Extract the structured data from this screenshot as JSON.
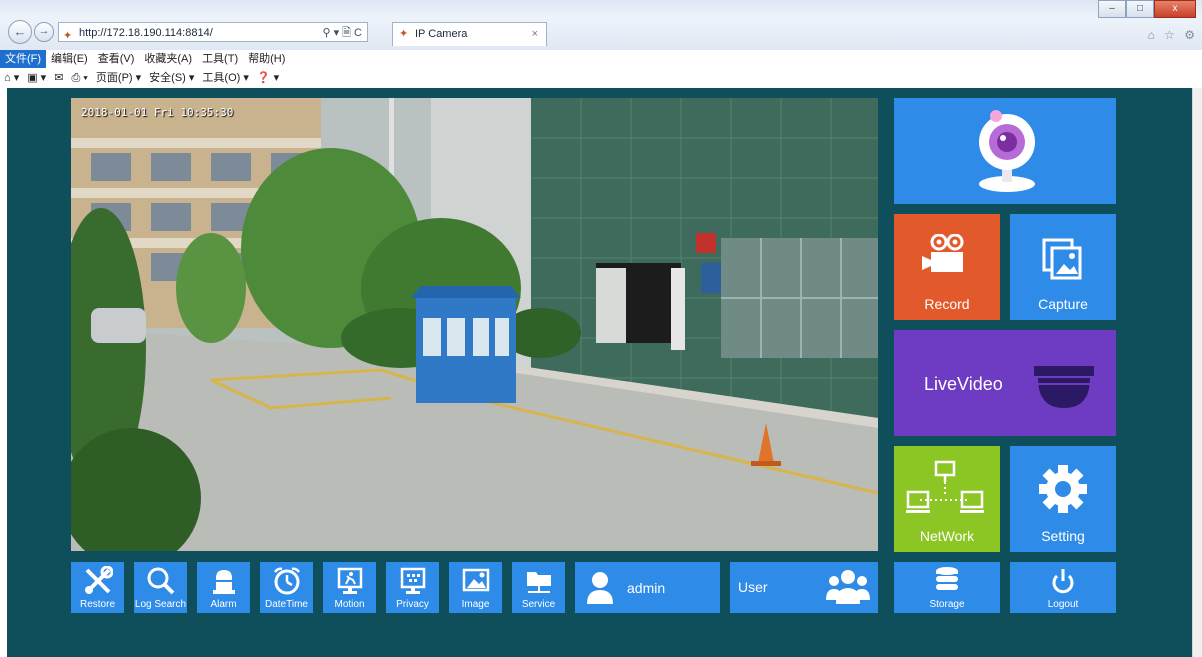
{
  "browser": {
    "url": "http://172.18.190.114:8814/",
    "address_tools": "⚲ ▾ 🗎 C",
    "tab_title": "IP Camera",
    "tab_close": "×",
    "back": "←",
    "forward": "→",
    "window_buttons": {
      "minimize": "–",
      "maximize": "□",
      "close": "x"
    },
    "right_icons": "⌂ ☆ ⚙"
  },
  "menu": [
    "文件(F)",
    "编辑(E)",
    "查看(V)",
    "收藏夹(A)",
    "工具(T)",
    "帮助(H)"
  ],
  "command_bar": [
    "⌂ ▾",
    "▣ ▾",
    "✉",
    "⎙ ▾",
    "页面(P) ▾",
    "安全(S) ▾",
    "工具(O) ▾",
    "❓ ▾"
  ],
  "video": {
    "osd_text": "2018-01-01 Fri 10:35:30"
  },
  "tiles": {
    "record": "Record",
    "capture": "Capture",
    "livevideo": "LiveVideo",
    "network": "NetWork",
    "setting": "Setting",
    "storage": "Storage",
    "logout": "Logout"
  },
  "toolbar": {
    "restore": "Restore",
    "log_search": "Log Search",
    "alarm": "Alarm",
    "datetime": "DateTime",
    "motion": "Motion",
    "privacy": "Privacy",
    "image": "Image",
    "service": "Service"
  },
  "user": {
    "name": "admin",
    "user_label": "User"
  },
  "colors": {
    "page_bg": "#0f4e5b",
    "tile_blue": "#2f8be8",
    "tile_orange": "#e25a2b",
    "tile_purple": "#6e3bc3",
    "tile_green": "#8bc624"
  }
}
